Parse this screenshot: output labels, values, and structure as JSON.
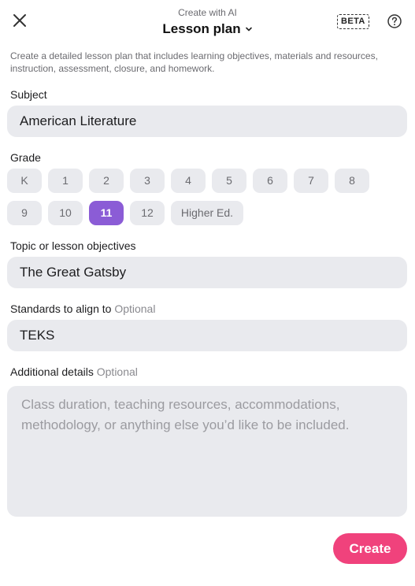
{
  "header": {
    "subtitle": "Create with AI",
    "title": "Lesson plan",
    "badge": "BETA"
  },
  "description": "Create a detailed lesson plan that includes learning objectives, materials and resources, instruction, assessment, closure, and homework.",
  "subject": {
    "label": "Subject",
    "value": "American Literature"
  },
  "grade": {
    "label": "Grade",
    "options": [
      "K",
      "1",
      "2",
      "3",
      "4",
      "5",
      "6",
      "7",
      "8",
      "9",
      "10",
      "11",
      "12",
      "Higher Ed."
    ],
    "selected": "11"
  },
  "topic": {
    "label": "Topic or lesson objectives",
    "value": "The Great Gatsby"
  },
  "standards": {
    "label": "Standards to align to",
    "optional": "Optional",
    "value": "TEKS"
  },
  "details": {
    "label": "Additional details",
    "optional": "Optional",
    "value": "",
    "placeholder": "Class duration, teaching resources, accommodations, methodology, or anything else you’d like to be included."
  },
  "actions": {
    "create_label": "Create"
  },
  "colors": {
    "accent": "#8b5cd6",
    "primary": "#f0427c",
    "field": "#e9eaee"
  },
  "icons": {
    "close": "close-icon",
    "title_dropdown": "chevron-down-icon",
    "help": "help-icon"
  }
}
